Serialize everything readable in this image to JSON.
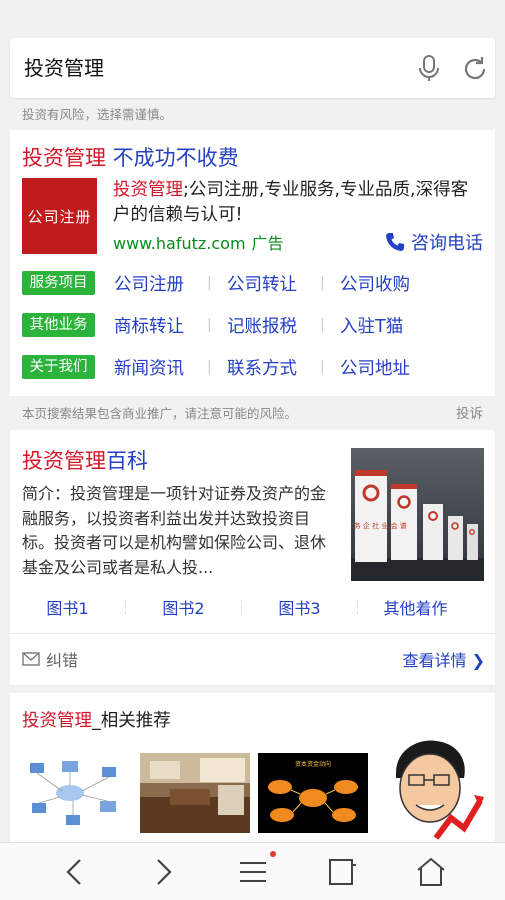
{
  "search": {
    "query": "投资管理"
  },
  "risk_note": "投资有风险，选择需谨慎。",
  "ad": {
    "title_highlight": "投资管理",
    "title_rest": " 不成功不收费",
    "thumb_text": "公司注册",
    "desc_highlight": "投资管理",
    "desc_rest": ";公司注册,专业服务,专业品质,深得客户的信赖与认可!",
    "url": "www.hafutz.com",
    "ad_tag": "广告",
    "call_label": "咨询电话",
    "sitelinks": [
      {
        "badge": "服务项目",
        "links": [
          "公司注册",
          "公司转让",
          "公司收购"
        ]
      },
      {
        "badge": "其他业务",
        "links": [
          "商标转让",
          "记账报税",
          "入驻T猫"
        ]
      },
      {
        "badge": "关于我们",
        "links": [
          "新闻资讯",
          "联系方式",
          "公司地址"
        ]
      }
    ]
  },
  "ads_note": "本页搜索结果包含商业推广，请注意可能的风险。",
  "report_label": "投诉",
  "baike": {
    "title_highlight": "投资管理",
    "title_rest": "百科",
    "summary": "简介：投资管理是一项针对证券及资产的金融服务，以投资者利益出发并达致投资目标。投资者可以是机构譬如保险公司、退休基金及公司或者是私人投...",
    "tabs": [
      "图书1",
      "图书2",
      "图书3",
      "其他着作"
    ],
    "feedback_label": "纠错",
    "more_label": "查看详情 ❯",
    "banner_text": "服 请 务 企 社 业 会 谱"
  },
  "related": {
    "title_highlight": "投资管理",
    "title_rest": "_相关推荐",
    "image3_text": "资本资金动向"
  },
  "colors": {
    "link": "#2441c4",
    "highlight": "#d5172a",
    "green": "#2bb33b",
    "url": "#0a8a1f"
  }
}
